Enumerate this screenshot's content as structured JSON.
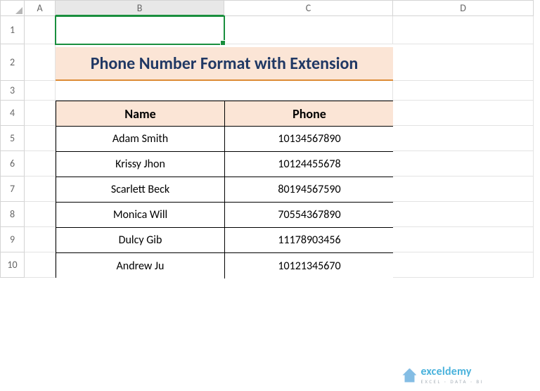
{
  "columns": [
    "A",
    "B",
    "C",
    "D"
  ],
  "rows": [
    "1",
    "2",
    "3",
    "4",
    "5",
    "6",
    "7",
    "8",
    "9",
    "10"
  ],
  "selected_column": "B",
  "title": "Phone Number Format with Extension",
  "table": {
    "headers": [
      "Name",
      "Phone"
    ],
    "data": [
      {
        "name": "Adam Smith",
        "phone": "10134567890"
      },
      {
        "name": "Krissy Jhon",
        "phone": "10124455678"
      },
      {
        "name": "Scarlett Beck",
        "phone": "80194567590"
      },
      {
        "name": "Monica Will",
        "phone": "70554367890"
      },
      {
        "name": "Dulcy Gib",
        "phone": "11178903456"
      },
      {
        "name": "Andrew Ju",
        "phone": "10121345670"
      }
    ]
  },
  "watermark": {
    "brand": "exceldemy",
    "tag": "EXCEL · DATA · BI"
  }
}
